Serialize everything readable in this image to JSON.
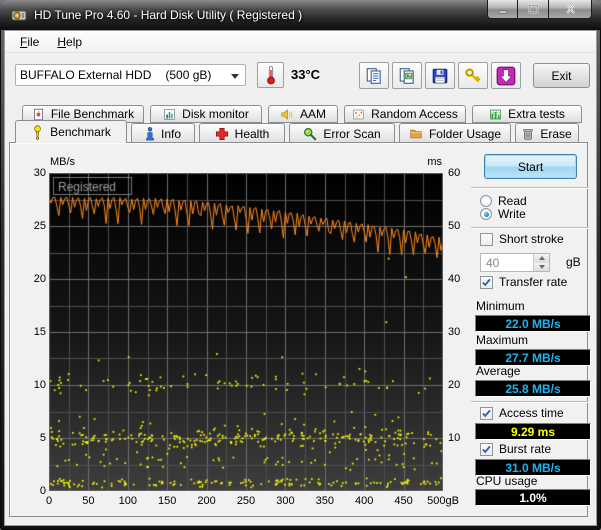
{
  "window": {
    "title": "HD Tune Pro 4.60 - Hard Disk Utility (  Registered )",
    "icons": {
      "minimize": "–",
      "maximize": "▢",
      "close": "✕"
    }
  },
  "menu": {
    "file_label": "File",
    "help_label": "Help"
  },
  "toolbar": {
    "device_select": {
      "name": "BUFFALO External HDD",
      "size": "(500 gB)"
    },
    "temperature": "33°C",
    "button_icons": [
      "copy-report-icon",
      "copy-image-icon",
      "save-icon",
      "keys-icon",
      "download-icon"
    ],
    "exit_label": "Exit"
  },
  "tabs": {
    "row1": [
      {
        "label": "File Benchmark"
      },
      {
        "label": "Disk monitor"
      },
      {
        "label": "AAM"
      },
      {
        "label": "Random Access"
      },
      {
        "label": "Extra tests"
      }
    ],
    "row2": [
      {
        "label": "Benchmark",
        "active": true
      },
      {
        "label": "Info"
      },
      {
        "label": "Health"
      },
      {
        "label": "Error Scan"
      },
      {
        "label": "Folder Usage"
      },
      {
        "label": "Erase"
      }
    ]
  },
  "panel": {
    "start_label": "Start",
    "read_label": "Read",
    "write_label": "Write",
    "write_selected": true,
    "short_stroke_label": "Short stroke",
    "short_stroke_checked": false,
    "short_stroke_value": "40",
    "short_stroke_unit": "gB",
    "transfer_rate_label": "Transfer rate",
    "transfer_rate_checked": true,
    "minimum_label": "Minimum",
    "minimum_value": "22.0 MB/s",
    "maximum_label": "Maximum",
    "maximum_value": "27.7 MB/s",
    "average_label": "Average",
    "average_value": "25.8 MB/s",
    "access_time_label": "Access time",
    "access_time_checked": true,
    "access_time_value": "9.29 ms",
    "burst_rate_label": "Burst rate",
    "burst_rate_checked": true,
    "burst_rate_value": "31.0 MB/s",
    "cpu_usage_label": "CPU usage",
    "cpu_usage_value": "1.0%"
  },
  "chart_data": {
    "type": "line+scatter",
    "watermark": "Registered",
    "background": [
      "#000000",
      "#161616",
      "#3e3e3e"
    ],
    "grid_color_minor": "#4f4f4f",
    "grid_color_major": "#6e6e6e",
    "x_axis": {
      "min": 0,
      "max": 500,
      "grid_step": 25,
      "tick_step": 50,
      "tick_labels": [
        "0",
        "50",
        "100",
        "150",
        "200",
        "250",
        "300",
        "350",
        "400",
        "450",
        "500gB"
      ]
    },
    "y_left": {
      "label": "MB/s",
      "min": 0,
      "max": 30,
      "grid_step": 2.5,
      "ticks": [
        30,
        25,
        20,
        15,
        10,
        5,
        0
      ]
    },
    "y_right": {
      "label": "ms",
      "min": 0,
      "max": 60,
      "ticks": [
        60,
        50,
        40,
        30,
        20,
        10
      ]
    },
    "series": [
      {
        "name": "transfer-rate",
        "type": "line",
        "axis": "left",
        "color": "#ff8a1e",
        "trend_points": [
          [
            0,
            27.4
          ],
          [
            50,
            27.2
          ],
          [
            100,
            27.2
          ],
          [
            150,
            27.1
          ],
          [
            200,
            26.8
          ],
          [
            250,
            26.4
          ],
          [
            300,
            25.9
          ],
          [
            350,
            25.3
          ],
          [
            400,
            24.7
          ],
          [
            450,
            24.2
          ],
          [
            500,
            23.4
          ]
        ],
        "noise": {
          "points": 200,
          "top": 0.35,
          "small_dip": 0.6,
          "deep_dip": 1.6,
          "min_clamp": 22.0,
          "max_clamp": 27.7,
          "seed": 7
        }
      },
      {
        "name": "access-time",
        "type": "scatter",
        "axis": "right",
        "color": "#ffff00",
        "dot_size": 1.7,
        "seed": 13,
        "bands": [
          {
            "center_ms": 10.2,
            "spread_ms": 1.5,
            "count": 250
          },
          {
            "center_ms": 20.5,
            "spread_ms": 1.7,
            "count": 80
          },
          {
            "center_ms": 1.7,
            "spread_ms": 0.8,
            "count": 150
          },
          {
            "center_ms": 6.0,
            "spread_ms": 2.2,
            "count": 70
          },
          {
            "center_ms": 13.5,
            "spread_ms": 1.5,
            "count": 18
          }
        ],
        "outliers": [
          [
            62,
            24.8
          ],
          [
            100,
            25.4
          ],
          [
            212,
            26.0
          ],
          [
            295,
            25.4
          ],
          [
            393,
            23.2
          ],
          [
            427,
            32.0
          ],
          [
            430,
            44.0
          ],
          [
            452,
            40.5
          ]
        ]
      }
    ],
    "stats": {
      "minimum": "22.0 MB/s",
      "maximum": "27.7 MB/s",
      "average": "25.8 MB/s",
      "access_time": "9.29 ms",
      "burst_rate": "31.0 MB/s",
      "cpu_usage": "1.0%"
    }
  }
}
